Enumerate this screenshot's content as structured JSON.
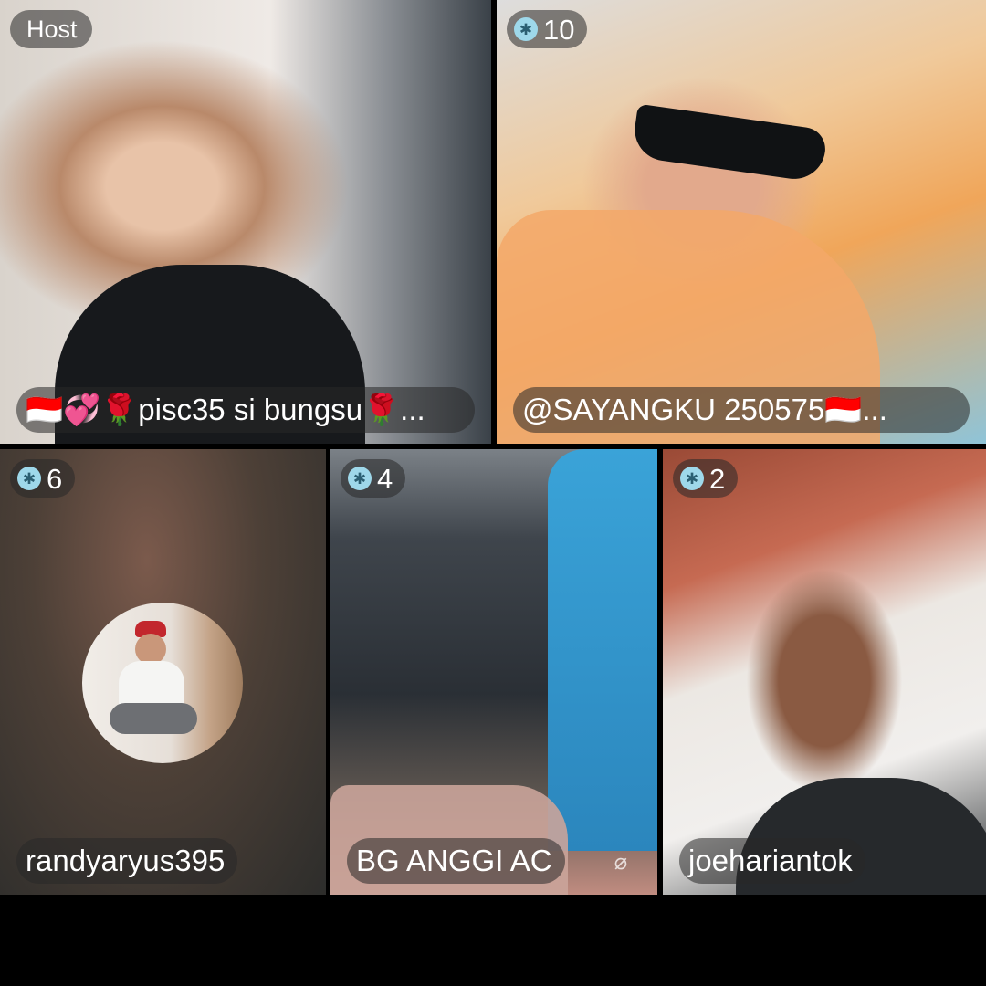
{
  "tiles": [
    {
      "badge": "Host",
      "name": "🇮🇩💞🌹pisc35 si bungsu🌹..."
    },
    {
      "badge": "10",
      "name": "@SAYANGKU 250575🇮🇩..."
    },
    {
      "badge": "6",
      "name": "randyaryus395"
    },
    {
      "badge": "4",
      "name": "BG ANGGI AC"
    },
    {
      "badge": "2",
      "name": "joehariantok"
    }
  ],
  "icons": {
    "badge": "snowflake-gem-icon",
    "mic": "mic-off-icon"
  },
  "colors": {
    "badge_icon": "#9ed8ea",
    "pill_bg": "rgba(40,40,40,0.55)"
  }
}
